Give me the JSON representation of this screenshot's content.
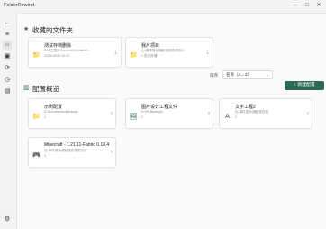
{
  "app": {
    "title": "FolderRewind"
  },
  "window_controls": {
    "minimize": "—",
    "maximize": "□",
    "close": "✕"
  },
  "rail": {
    "items": [
      {
        "name": "back-icon",
        "glyph": "←"
      },
      {
        "name": "menu-icon",
        "glyph": "≡"
      },
      {
        "name": "home-icon",
        "glyph": "⌂"
      },
      {
        "name": "archive-icon",
        "glyph": "▣"
      },
      {
        "name": "sync-icon",
        "glyph": "⟳"
      },
      {
        "name": "history-icon",
        "glyph": "◷"
      },
      {
        "name": "log-icon",
        "glyph": "▤"
      },
      {
        "name": "settings-icon",
        "glyph": "⚙"
      }
    ]
  },
  "favorites": {
    "title": "收藏的文件夹",
    "icon": "★",
    "cards": [
      {
        "title": "测试存档删除",
        "path": "D:\\A工程\\C\\Lumenol\\Versions\\...",
        "meta": "2025/10/30 10:23",
        "icon": "📁"
      },
      {
        "title": "我片项目",
        "path": "出.事件成功调起或存档\\项目1",
        "meta": "1 张已存储",
        "icon": "📁"
      }
    ]
  },
  "configs": {
    "title": "配置概览",
    "icon": "▥",
    "sort_label": "排序",
    "sort_value": "名称（A→Z）",
    "new_button": "+ 新建配置",
    "cards": [
      {
        "title": "示例配置",
        "path": "D:\\Documents\\Backups",
        "meta": "2",
        "icon": "📁"
      },
      {
        "title": "图片设计工程文件",
        "path": "D:\\Pt_Backups",
        "meta": "2",
        "icon": "🖼"
      },
      {
        "title": "文字工程2",
        "path": "出.事件成功调起或存档",
        "meta": "2",
        "icon": "A"
      },
      {
        "title": "Minecraft - 1.21.11-Fabric 0.18.4",
        "path": "出.事件成功调起或存档的方法",
        "meta": "3",
        "icon": "🎮"
      }
    ]
  }
}
